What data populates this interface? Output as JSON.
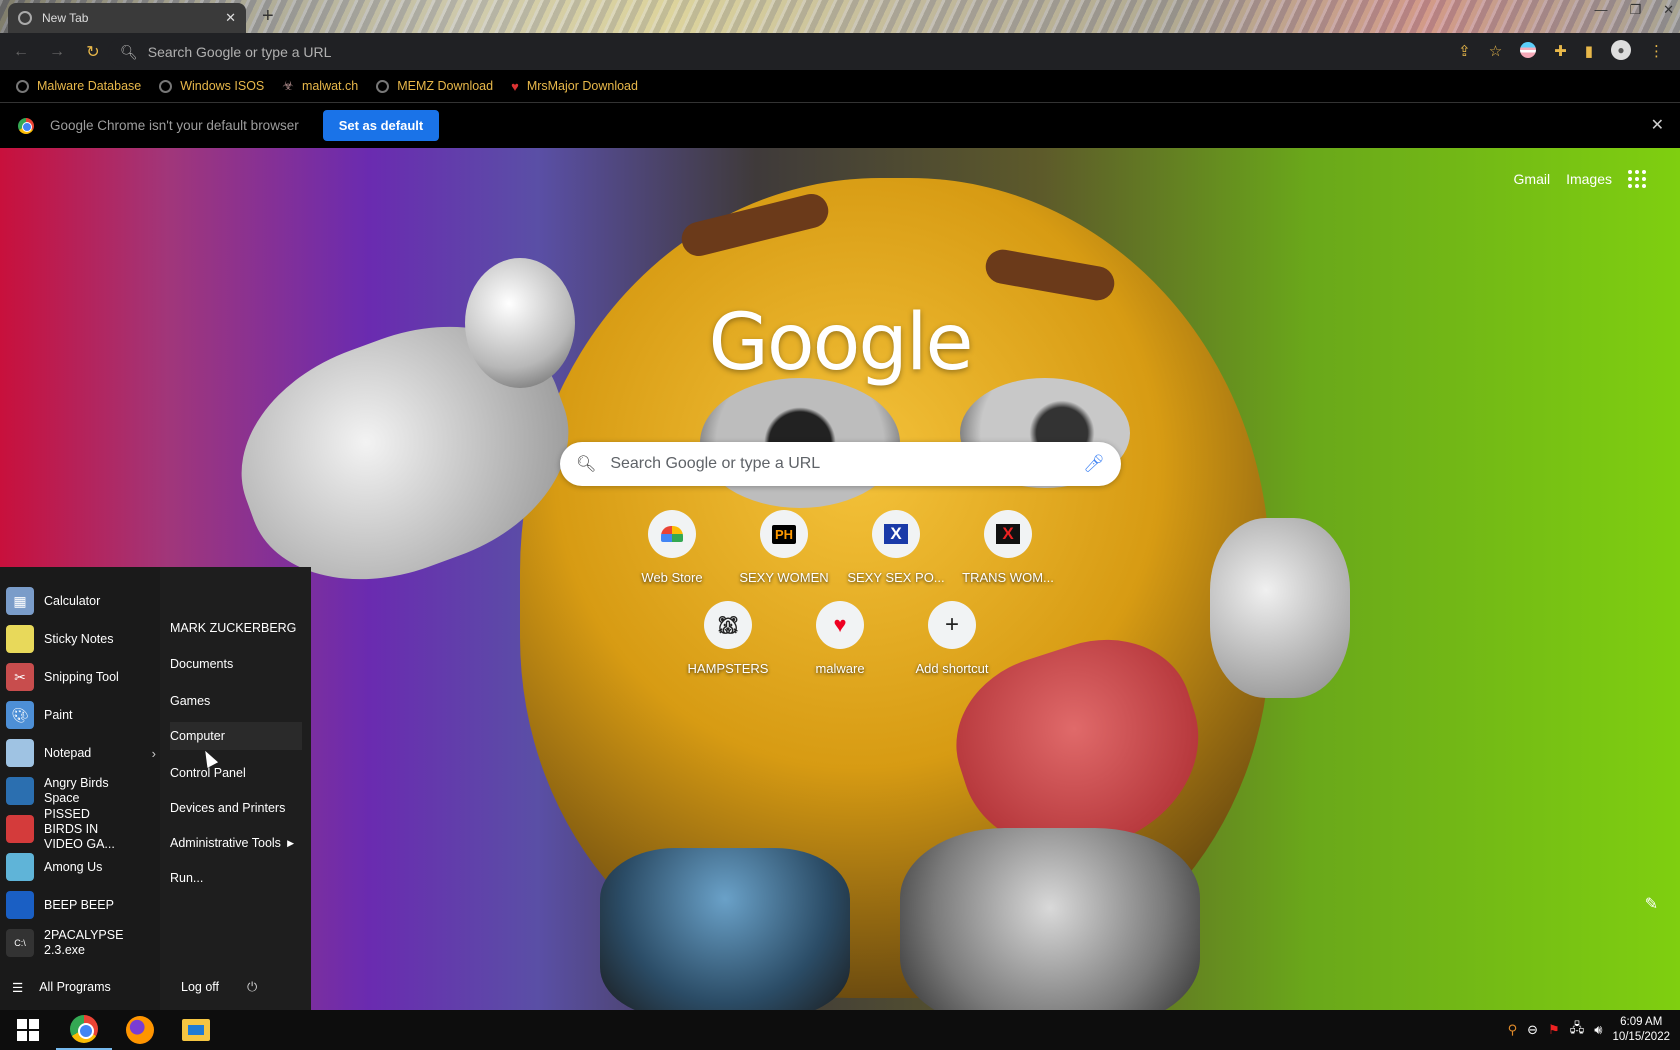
{
  "tab": {
    "title": "New Tab"
  },
  "toolbar": {
    "omnibox_placeholder": "Search Google or type a URL"
  },
  "bookmarks": [
    {
      "label": "Malware Database",
      "icon": "globe-icon"
    },
    {
      "label": "Windows ISOS",
      "icon": "globe-icon"
    },
    {
      "label": "malwat.ch",
      "icon": "biohazard-icon"
    },
    {
      "label": "MEMZ Download",
      "icon": "globe-icon"
    },
    {
      "label": "MrsMajor Download",
      "icon": "heart-icon"
    }
  ],
  "infobar": {
    "message": "Google Chrome isn't your default browser",
    "button": "Set as default"
  },
  "ntp": {
    "links": {
      "gmail": "Gmail",
      "images": "Images"
    },
    "logo": "Google",
    "search_placeholder": "Search Google or type a URL",
    "shortcuts": [
      {
        "label": "Web Store",
        "icon": "webstore-icon"
      },
      {
        "label": "SEXY WOMEN",
        "icon": "PH"
      },
      {
        "label": "SEXY SEX PO...",
        "icon": "X"
      },
      {
        "label": "TRANS WOM...",
        "icon": "X"
      },
      {
        "label": "HAMPSTERS",
        "icon": "hamster-icon"
      },
      {
        "label": "malware",
        "icon": "heart-icon"
      },
      {
        "label": "Add shortcut",
        "icon": "+"
      }
    ]
  },
  "startmenu": {
    "programs": [
      {
        "label": "Calculator",
        "icon_color": "#7a9cc9"
      },
      {
        "label": "Sticky Notes",
        "icon_color": "#e8d95a"
      },
      {
        "label": "Snipping Tool",
        "icon_color": "#c84d4d"
      },
      {
        "label": "Paint",
        "icon_color": "#4d8fd6"
      },
      {
        "label": "Notepad",
        "icon_color": "#9fc3e3"
      },
      {
        "label": "Angry Birds Space",
        "icon_color": "#2b6fb0"
      },
      {
        "label": "PISSED BIRDS IN VIDEO GA...",
        "icon_color": "#d43b3b"
      },
      {
        "label": "Among Us",
        "icon_color": "#5fb4d8"
      },
      {
        "label": "BEEP BEEP",
        "icon_color": "#1a5fc4"
      },
      {
        "label": "2PACALYPSE 2.3.exe",
        "icon_color": "#333333"
      }
    ],
    "places": [
      "MARK ZUCKERBERG",
      "Documents",
      "Games",
      "Computer",
      "Control Panel",
      "Devices and Printers",
      "Administrative Tools",
      "Run..."
    ],
    "all_programs": "All Programs",
    "logoff": "Log off"
  },
  "taskbar": {
    "time": "6:09 AM",
    "date": "10/15/2022"
  }
}
